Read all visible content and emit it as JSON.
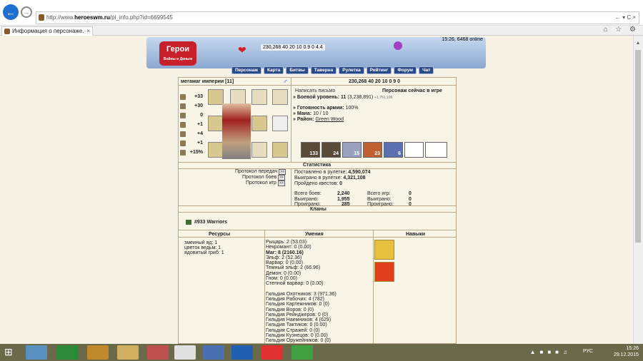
{
  "browser": {
    "url_prefix": "http://www.",
    "url_domain": "heroeswm.ru",
    "url_path": "/pl_info.php?id=6699545",
    "address_right": "← ▾ C  ×",
    "tab_title": "Информация о персонаже.",
    "tab_close": "×",
    "tab_icons": "⌂ ☆ ⚙"
  },
  "banner": {
    "logo": "Герои",
    "logo_sub": "Войны и Деньги",
    "resources": "230,268  40  20  10  0  9  0  4.4",
    "online": "15:26, 6468 online"
  },
  "menu": [
    "Персонаж",
    "Карта",
    "Битвы",
    "Таверна",
    "Рулетка",
    "Рейтинг",
    "Форум",
    "Чат"
  ],
  "player": {
    "name": "мегамаг империи",
    "level_badge": "[11]",
    "resources": "230,268   40   20   10   0   9   0",
    "write_letter": "Написать письмо",
    "status": "Персонаж сейчас в игре",
    "combat_level_label": "» Боевой уровень:",
    "combat_level": "11",
    "combat_exp": "(3,238,891)",
    "combat_exp_small": "+1,761,109",
    "army_label": "» Готовность армии:",
    "army": "100%",
    "mana_label": "» Мана:",
    "mana": "10 / 10",
    "district_label": "» Район:",
    "district": "Green Wood"
  },
  "stats": [
    {
      "icon": "attack-icon",
      "value": "+33"
    },
    {
      "icon": "defense-icon",
      "value": "+30"
    },
    {
      "icon": "spellpower-icon",
      "value": "0"
    },
    {
      "icon": "knowledge-icon",
      "value": "+1"
    },
    {
      "icon": "luck-icon",
      "value": "+4"
    },
    {
      "icon": "morale-icon",
      "value": "+1"
    },
    {
      "icon": "initiative-icon",
      "value": "+15%"
    }
  ],
  "army_units": [
    "133",
    "24",
    "15",
    "23",
    "6",
    "",
    ""
  ],
  "statistics": {
    "header": "Статистика",
    "links": [
      "Протокол передач",
      "Протокол боев",
      "Протокол игр"
    ],
    "link_btn": ">>",
    "roulette_bet_label": "Поставлено в рулетке:",
    "roulette_bet": "4,590,074",
    "roulette_win_label": "Выиграно в рулетке:",
    "roulette_win": "4,321,108",
    "quests_label": "Пройдено квестов:",
    "quests": "0",
    "battles_label": "Всего боев:",
    "battles": "2,240",
    "battles_won_label": "Выиграно:",
    "battles_won": "1,955",
    "battles_lost_label": "Проиграно:",
    "battles_lost": "285",
    "games_label": "Всего игр:",
    "games": "0",
    "games_won_label": "Выиграно:",
    "games_won": "0",
    "games_lost_label": "Проиграно:",
    "games_lost": "0"
  },
  "clans": {
    "header": "Кланы",
    "clan": "#933 Warriors"
  },
  "resources_col": {
    "header": "Ресурсы",
    "items": [
      "змеиный яд: 1",
      "цветок ведьм: 1",
      "ядовитый гриб: 1"
    ]
  },
  "skills_col": {
    "header": "Умения",
    "lines": [
      "Рыцарь: 2 (53.03)",
      "Некромант: 0 (0.00)",
      "Маг: 8 (2160.16)",
      "Эльф: 2 (52.36)",
      "Варвар: 0 (0.00)",
      "Темный эльф: 2 (66.96)",
      "Демон: 0 (0.00)",
      "Гном: 0 (0.00)",
      "Степной варвар: 0 (0.00)",
      "",
      "Гильдия Охотников: 3 (971.36)",
      "Гильдия Рабочих: 4 (782)",
      "Гильдия Картежников: 0 (0)",
      "Гильдия Воров: 0 (0)",
      "Гильдия Рейнджеров: 0 (0)",
      "Гильдия Наемников: 4 (629)",
      "Гильдия Тактиков: 0 (0.00)",
      "Гильдия Стражей: 0 (0)",
      "Гильдия Кузнецов: 0 (0.00)",
      "Гильдия Оружейников: 0 (0)"
    ]
  },
  "perks_col": {
    "header": "Навыки"
  },
  "taskbar": {
    "lang": "РУС",
    "time": "15:26",
    "date": "29.12.2015"
  }
}
